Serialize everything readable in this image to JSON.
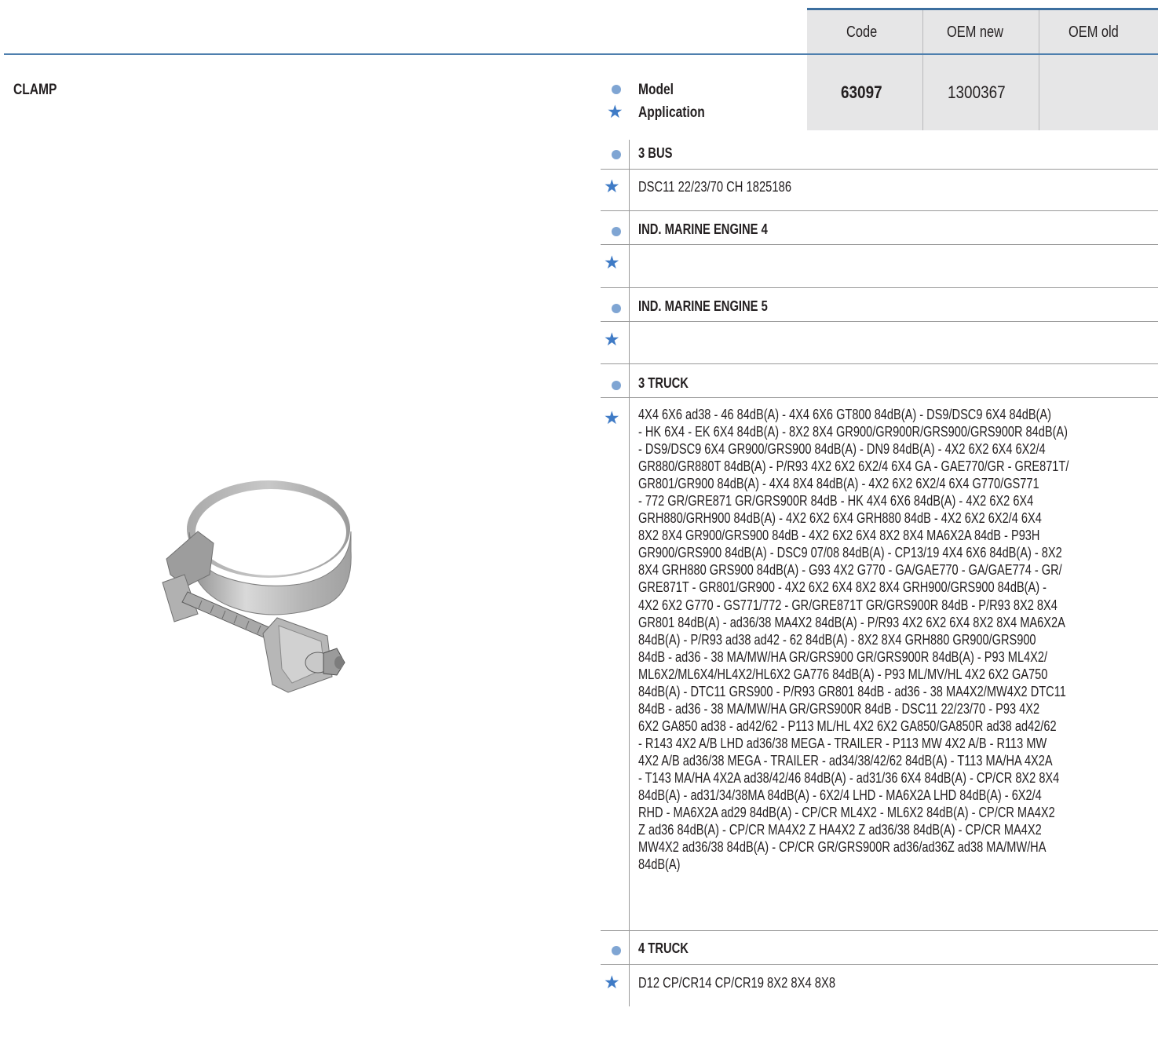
{
  "header": {
    "code_label": "Code",
    "oem_new_label": "OEM new",
    "oem_old_label": "OEM old"
  },
  "part": {
    "title": "CLAMP",
    "code": "63097",
    "oem_new": "1300367",
    "oem_old": ""
  },
  "legend": {
    "model_label": "Model",
    "application_label": "Application"
  },
  "icons": {
    "model_marker": "dot-icon",
    "application_marker": "star-icon"
  },
  "colors": {
    "accent": "#4e7fae",
    "dot": "#7fa5d3",
    "star": "#3f7bc6",
    "header_bg": "#e6e6e7"
  },
  "entries": [
    {
      "model": "3 BUS",
      "application_lines": [
        "DSC11 22/23/70 CH 1825186"
      ]
    },
    {
      "model": "IND. MARINE ENGINE 4",
      "application_lines": []
    },
    {
      "model": "IND. MARINE ENGINE 5",
      "application_lines": []
    },
    {
      "model": "3 TRUCK",
      "application_lines": [
        "4X4 6X6 ad38 - 46 84dB(A) - 4X4 6X6 GT800 84dB(A) - DS9/DSC9 6X4 84dB(A)",
        "- HK 6X4 - EK 6X4 84dB(A) - 8X2 8X4 GR900/GR900R/GRS900/GRS900R 84dB(A)",
        "- DS9/DSC9 6X4 GR900/GRS900 84dB(A) - DN9 84dB(A) - 4X2 6X2 6X4 6X2/4",
        "GR880/GR880T 84dB(A) - P/R93 4X2 6X2 6X2/4 6X4 GA - GAE770/GR - GRE871T/",
        "GR801/GR900 84dB(A) - 4X4 8X4 84dB(A) - 4X2 6X2 6X2/4 6X4 G770/GS771",
        "- 772 GR/GRE871 GR/GRS900R 84dB - HK 4X4 6X6 84dB(A) - 4X2 6X2 6X4",
        "GRH880/GRH900 84dB(A) - 4X2 6X2 6X4 GRH880 84dB - 4X2 6X2 6X2/4 6X4",
        "8X2 8X4 GR900/GRS900 84dB - 4X2 6X2 6X4 8X2 8X4 MA6X2A 84dB - P93H",
        "GR900/GRS900 84dB(A) - DSC9 07/08 84dB(A) - CP13/19 4X4 6X6 84dB(A) - 8X2",
        "8X4 GRH880 GRS900 84dB(A) - G93 4X2 G770 - GA/GAE770 - GA/GAE774 - GR/",
        "GRE871T - GR801/GR900 - 4X2 6X2 6X4 8X2 8X4 GRH900/GRS900 84dB(A) -",
        "4X2 6X2 G770 - GS771/772 - GR/GRE871T GR/GRS900R 84dB - P/R93 8X2 8X4",
        "GR801 84dB(A) - ad36/38 MA4X2 84dB(A) - P/R93 4X2 6X2 6X4 8X2 8X4 MA6X2A",
        "84dB(A) - P/R93 ad38 ad42 - 62 84dB(A) - 8X2 8X4 GRH880 GR900/GRS900",
        "84dB - ad36 - 38 MA/MW/HA GR/GRS900 GR/GRS900R 84dB(A) - P93 ML4X2/",
        "ML6X2/ML6X4/HL4X2/HL6X2 GA776 84dB(A) - P93 ML/MV/HL 4X2 6X2 GA750",
        "84dB(A) - DTC11 GRS900 - P/R93 GR801 84dB - ad36 - 38 MA4X2/MW4X2 DTC11",
        "84dB - ad36 - 38 MA/MW/HA GR/GRS900R 84dB - DSC11 22/23/70 - P93 4X2",
        "6X2 GA850 ad38 - ad42/62 - P113 ML/HL 4X2 6X2 GA850/GA850R ad38 ad42/62",
        "- R143 4X2 A/B LHD ad36/38 MEGA - TRAILER - P113 MW 4X2 A/B - R113 MW",
        "4X2 A/B ad36/38 MEGA - TRAILER - ad34/38/42/62 84dB(A) - T113 MA/HA 4X2A",
        "- T143 MA/HA 4X2A ad38/42/46 84dB(A) - ad31/36 6X4 84dB(A) - CP/CR 8X2 8X4",
        "84dB(A) - ad31/34/38MA 84dB(A) - 6X2/4 LHD - MA6X2A LHD 84dB(A) - 6X2/4",
        "RHD - MA6X2A ad29 84dB(A) - CP/CR ML4X2 - ML6X2 84dB(A) - CP/CR MA4X2",
        "Z ad36 84dB(A) - CP/CR MA4X2 Z HA4X2 Z ad36/38 84dB(A) - CP/CR MA4X2",
        "MW4X2 ad36/38 84dB(A) - CP/CR GR/GRS900R ad36/ad36Z ad38 MA/MW/HA",
        "84dB(A)"
      ]
    },
    {
      "model": "4 TRUCK",
      "application_lines": [
        "D12 CP/CR14 CP/CR19 8X2 8X4 8X8"
      ]
    }
  ]
}
